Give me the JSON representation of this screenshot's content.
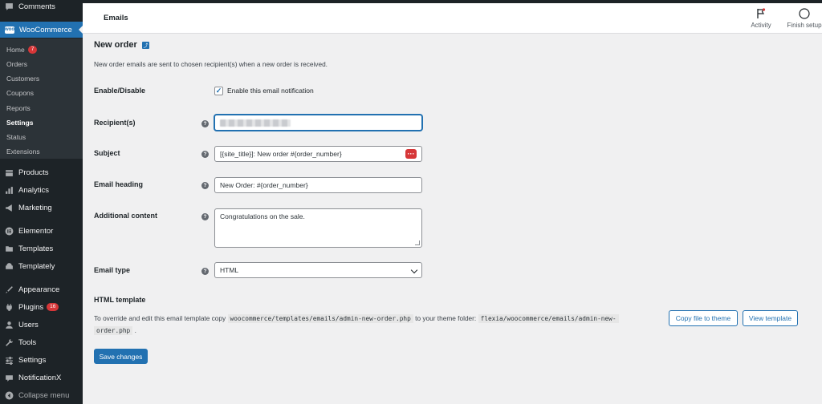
{
  "sidebar": {
    "comments": "Comments",
    "woocommerce": "WooCommerce",
    "submenu": {
      "home": "Home",
      "home_badge": "7",
      "orders": "Orders",
      "customers": "Customers",
      "coupons": "Coupons",
      "reports": "Reports",
      "settings": "Settings",
      "status": "Status",
      "extensions": "Extensions"
    },
    "products": "Products",
    "analytics": "Analytics",
    "marketing": "Marketing",
    "elementor": "Elementor",
    "templates": "Templates",
    "templately": "Templately",
    "appearance": "Appearance",
    "plugins": "Plugins",
    "plugins_badge": "16",
    "users": "Users",
    "tools": "Tools",
    "settings": "Settings",
    "notificationx": "NotificationX",
    "collapse": "Collapse menu"
  },
  "header": {
    "title": "Emails",
    "activity": "Activity",
    "finish_setup": "Finish setup"
  },
  "main": {
    "heading": "New order",
    "up_link_icon": "up-arrow-icon",
    "description": "New order emails are sent to chosen recipient(s) when a new order is received.",
    "enable_label": "Enable/Disable",
    "enable_checkbox_label": "Enable this email notification",
    "enable_checked": true,
    "recipients_label": "Recipient(s)",
    "subject_label": "Subject",
    "subject_value": "[{site_title}]: New order #{order_number}",
    "email_heading_label": "Email heading",
    "email_heading_value": "New Order: #{order_number}",
    "additional_label": "Additional content",
    "additional_value": "Congratulations on the sale.",
    "email_type_label": "Email type",
    "email_type_value": "HTML",
    "template_heading": "HTML template",
    "template_text_1": "To override and edit this email template copy",
    "template_code_1": "woocommerce/templates/emails/admin-new-order.php",
    "template_text_2": "to your theme folder:",
    "template_code_2a": "flexia/woocommerce/emails/admin-new-",
    "template_code_2b": "order.php",
    "template_text_3": ".",
    "copy_button": "Copy file to theme",
    "view_button": "View template",
    "save_button": "Save changes",
    "help_glyph": "?"
  },
  "colors": {
    "sidebar_bg": "#1d2327",
    "accent": "#2271b1",
    "badge": "#d63638"
  }
}
